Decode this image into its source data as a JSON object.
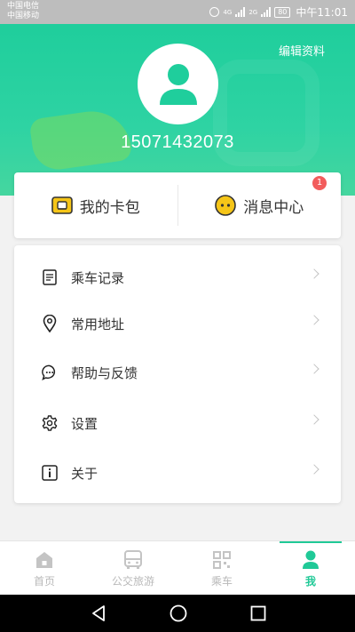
{
  "status_bar": {
    "carrier_1": "中国电信",
    "carrier_2": "中国移动",
    "net_1": "4G",
    "net_2": "2G",
    "battery": "80",
    "time": "中午11:01"
  },
  "profile": {
    "edit_label": "编辑资料",
    "phone": "15071432073"
  },
  "quick": {
    "wallet_label": "我的卡包",
    "messages_label": "消息中心",
    "messages_badge": "1"
  },
  "menu": {
    "items": [
      {
        "label": "乘车记录",
        "icon": "document-icon"
      },
      {
        "label": "常用地址",
        "icon": "location-pin-icon"
      },
      {
        "label": "帮助与反馈",
        "icon": "chat-bubble-icon"
      },
      {
        "label": "设置",
        "icon": "gear-icon"
      },
      {
        "label": "关于",
        "icon": "info-icon"
      }
    ]
  },
  "tabs": [
    {
      "label": "首页",
      "icon": "home-icon",
      "active": false
    },
    {
      "label": "公交旅游",
      "icon": "bus-icon",
      "active": false
    },
    {
      "label": "乘车",
      "icon": "qr-code-icon",
      "active": false
    },
    {
      "label": "我",
      "icon": "user-icon",
      "active": true
    }
  ],
  "colors": {
    "accent": "#20c997",
    "header_top": "#1fce9c",
    "badge": "#f25c5c",
    "wallet_icon": "#f5c518"
  }
}
